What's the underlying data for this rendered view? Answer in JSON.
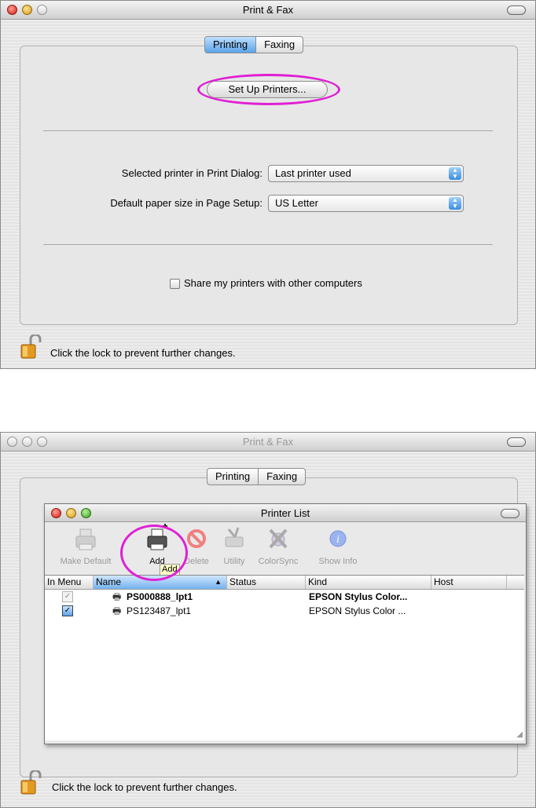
{
  "window1": {
    "title": "Print & Fax",
    "tabs": [
      {
        "label": "Printing",
        "selected": true
      },
      {
        "label": "Faxing",
        "selected": false
      }
    ],
    "setup_button": "Set Up Printers...",
    "selected_printer_label": "Selected printer in Print Dialog:",
    "selected_printer_value": "Last printer used",
    "paper_size_label": "Default paper size in Page Setup:",
    "paper_size_value": "US Letter",
    "share_label": "Share my printers with other computers",
    "lock_text": "Click the lock to prevent further changes."
  },
  "window2": {
    "title": "Print & Fax",
    "tabs": [
      {
        "label": "Printing"
      },
      {
        "label": "Faxing"
      }
    ],
    "lock_text": "Click the lock to prevent further changes."
  },
  "printer_list": {
    "title": "Printer List",
    "toolbar": {
      "make_default": "Make Default",
      "add": "Add",
      "delete": "Delete",
      "utility": "Utility",
      "colorsync": "ColorSync",
      "show_info": "Show Info",
      "tooltip": "Add"
    },
    "columns": {
      "in_menu": "In Menu",
      "name": "Name",
      "status": "Status",
      "kind": "Kind",
      "host": "Host"
    },
    "rows": [
      {
        "name": "PS000888_lpt1",
        "kind": "EPSON Stylus Color...",
        "in_menu": true
      },
      {
        "name": "PS123487_lpt1",
        "kind": "EPSON Stylus Color ...",
        "in_menu": true
      }
    ]
  },
  "colors": {
    "highlight_ellipse": "#e01fd4",
    "aqua_blue": "#5aa3e8"
  }
}
